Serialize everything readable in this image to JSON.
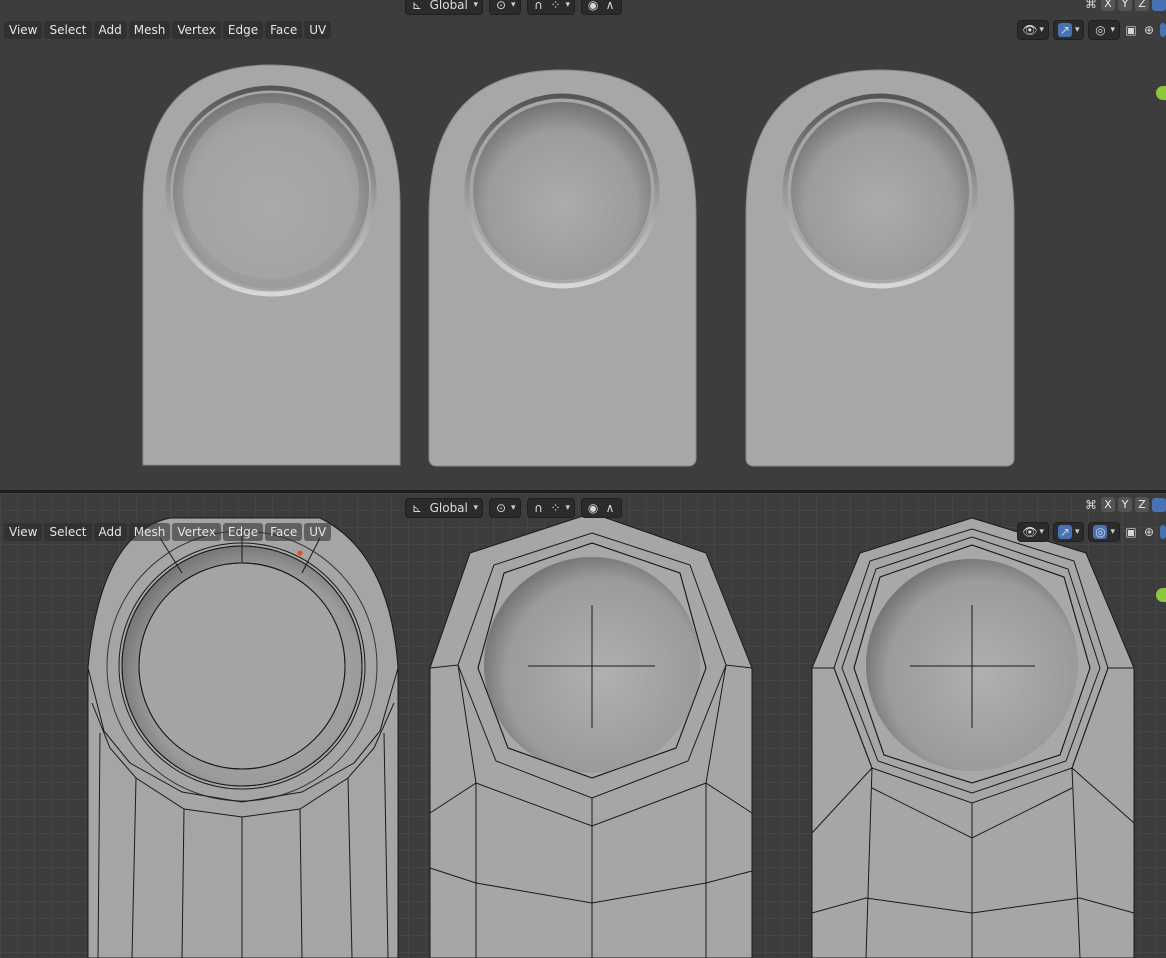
{
  "top_viewport": {
    "header": {
      "orientation_label": "Global",
      "axes": [
        "X",
        "Y",
        "Z"
      ]
    },
    "menu": [
      "View",
      "Select",
      "Add",
      "Mesh",
      "Vertex",
      "Edge",
      "Face",
      "UV"
    ]
  },
  "bottom_viewport": {
    "header": {
      "orientation_label": "Global",
      "axes": [
        "X",
        "Y",
        "Z"
      ]
    },
    "menu": [
      "View",
      "Select",
      "Add",
      "Mesh",
      "Vertex",
      "Edge",
      "Face",
      "UV"
    ]
  },
  "icons": {
    "transform_pivot": "pivot-icon",
    "snap": "magnet-icon",
    "snap_element": "grid-snap-icon",
    "proportional": "proportional-edit-icon",
    "falloff": "falloff-curve-icon",
    "visibility": "eye-icon",
    "gizmo": "gizmo-icon",
    "overlay": "overlay-icon",
    "xray": "xray-icon",
    "shading": "wireframe-sphere-icon"
  },
  "colors": {
    "viewport_bg": "#3d3d3d",
    "mesh_surface": "#a6a6a6",
    "active_toggle": "#4772b3",
    "gizmo_y_axis": "#8cc63f",
    "selected_vertex": "#e05020"
  }
}
